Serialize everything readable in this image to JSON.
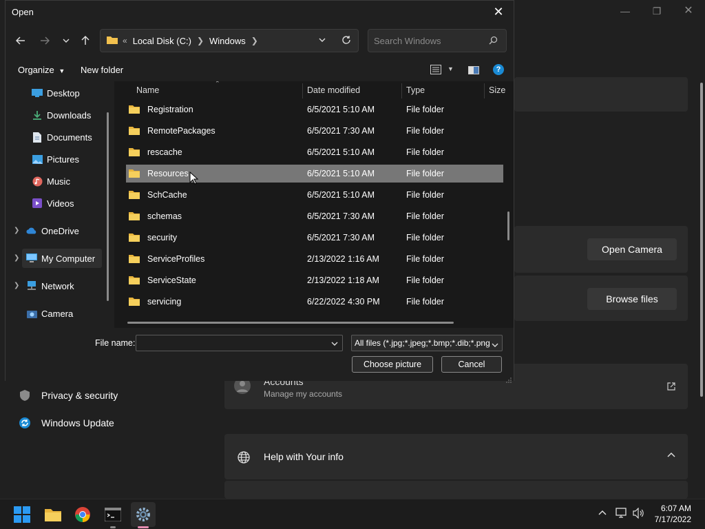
{
  "dialog": {
    "title": "Open",
    "address": {
      "overflow": "«",
      "crumbs": [
        "Local Disk (C:)",
        "Windows"
      ]
    },
    "search_placeholder": "Search Windows",
    "commands": {
      "organize": "Organize",
      "new_folder": "New folder"
    },
    "sidebar": {
      "quick": [
        {
          "label": "Desktop",
          "icon": "desktop-icon",
          "pinned": true
        },
        {
          "label": "Downloads",
          "icon": "download-icon",
          "pinned": true
        },
        {
          "label": "Documents",
          "icon": "documents-icon",
          "pinned": true
        },
        {
          "label": "Pictures",
          "icon": "pictures-icon",
          "pinned": true
        },
        {
          "label": "Music",
          "icon": "music-icon",
          "pinned": false
        },
        {
          "label": "Videos",
          "icon": "videos-icon",
          "pinned": false
        }
      ],
      "roots": [
        {
          "label": "OneDrive",
          "icon": "cloud-icon"
        },
        {
          "label": "My Computer",
          "icon": "computer-icon",
          "selected": true
        },
        {
          "label": "Network",
          "icon": "network-icon"
        },
        {
          "label": "Camera",
          "icon": "camera-icon"
        }
      ]
    },
    "columns": [
      "Name",
      "Date modified",
      "Type",
      "Size"
    ],
    "files": [
      {
        "name": "Registration",
        "date": "6/5/2021 5:10 AM",
        "type": "File folder"
      },
      {
        "name": "RemotePackages",
        "date": "6/5/2021 7:30 AM",
        "type": "File folder"
      },
      {
        "name": "rescache",
        "date": "6/5/2021 5:10 AM",
        "type": "File folder"
      },
      {
        "name": "Resources",
        "date": "6/5/2021 5:10 AM",
        "type": "File folder",
        "selected": true
      },
      {
        "name": "SchCache",
        "date": "6/5/2021 5:10 AM",
        "type": "File folder"
      },
      {
        "name": "schemas",
        "date": "6/5/2021 7:30 AM",
        "type": "File folder"
      },
      {
        "name": "security",
        "date": "6/5/2021 7:30 AM",
        "type": "File folder"
      },
      {
        "name": "ServiceProfiles",
        "date": "2/13/2022 1:16 AM",
        "type": "File folder"
      },
      {
        "name": "ServiceState",
        "date": "2/13/2022 1:18 AM",
        "type": "File folder"
      },
      {
        "name": "servicing",
        "date": "6/22/2022 4:30 PM",
        "type": "File folder"
      }
    ],
    "file_name_label": "File name:",
    "file_name_value": "",
    "file_type": "All files (*.jpg;*.jpeg;*.bmp;*.dib;*.png",
    "choose_button": "Choose picture",
    "cancel_button": "Cancel"
  },
  "settings": {
    "open_camera": "Open Camera",
    "browse_files": "Browse files",
    "accounts_title": "Accounts",
    "accounts_sub": "Manage my accounts",
    "help_title": "Help with Your info",
    "nav": [
      {
        "label": "Privacy & security",
        "icon": "shield-icon"
      },
      {
        "label": "Windows Update",
        "icon": "update-icon"
      }
    ]
  },
  "taskbar": {
    "apps": [
      "start-icon",
      "file-explorer-icon",
      "chrome-icon",
      "terminal-icon",
      "settings-icon"
    ],
    "time": "6:07 AM",
    "date": "7/17/2022"
  },
  "colors": {
    "accent": "#0078d4",
    "selection": "#777777",
    "folder": "#f2c14e"
  }
}
